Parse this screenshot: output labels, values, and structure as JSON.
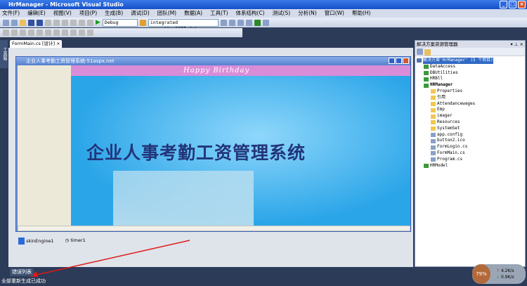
{
  "window": {
    "title": "HrManager - Microsoft Visual Studio"
  },
  "menu": [
    "文件(F)",
    "编辑(E)",
    "视图(V)",
    "项目(P)",
    "生成(B)",
    "调试(D)",
    "团队(M)",
    "数据(A)",
    "工具(T)",
    "体系结构(C)",
    "测试(S)",
    "分析(N)",
    "窗口(W)",
    "帮助(H)"
  ],
  "toolbar": {
    "config": "Debug",
    "connection": "integrated security=SSPI;dat"
  },
  "left_tab": "工具箱",
  "doc_tab": "FormMain.cs [设计]",
  "form": {
    "title": "企业人事考勤工资管理系统-51aspx.net",
    "banner": "Happy Birthday",
    "headline": "企业人事考勤工资管理系统"
  },
  "tray": [
    "skinEngine1",
    "timer1"
  ],
  "solution": {
    "title": "解决方案资源管理器",
    "items": [
      {
        "label": "解决方案'HrManager' (5 个项目)",
        "level": 0,
        "selected": true
      },
      {
        "label": "DataAccess",
        "level": 1
      },
      {
        "label": "DBUtilities",
        "level": 1
      },
      {
        "label": "HRBll",
        "level": 1
      },
      {
        "label": "HRManager",
        "level": 1,
        "bold": true
      },
      {
        "label": "Properties",
        "level": 2
      },
      {
        "label": "引用",
        "level": 2
      },
      {
        "label": "Attendancewages",
        "level": 2
      },
      {
        "label": "Emp",
        "level": 2
      },
      {
        "label": "imager",
        "level": 2
      },
      {
        "label": "Resources",
        "level": 2
      },
      {
        "label": "SystemSet",
        "level": 2
      },
      {
        "label": "app.config",
        "level": 2
      },
      {
        "label": "button2.ico",
        "level": 2
      },
      {
        "label": "FormLogin.cs",
        "level": 2
      },
      {
        "label": "FormMain.cs",
        "level": 2
      },
      {
        "label": "Program.cs",
        "level": 2
      },
      {
        "label": "HRModel",
        "level": 1
      }
    ]
  },
  "error_list": "错误列表",
  "status": "全部重新生成已成功",
  "widget": {
    "percent": "79%",
    "up": "4.2K/s",
    "down": "0.9K/s"
  }
}
